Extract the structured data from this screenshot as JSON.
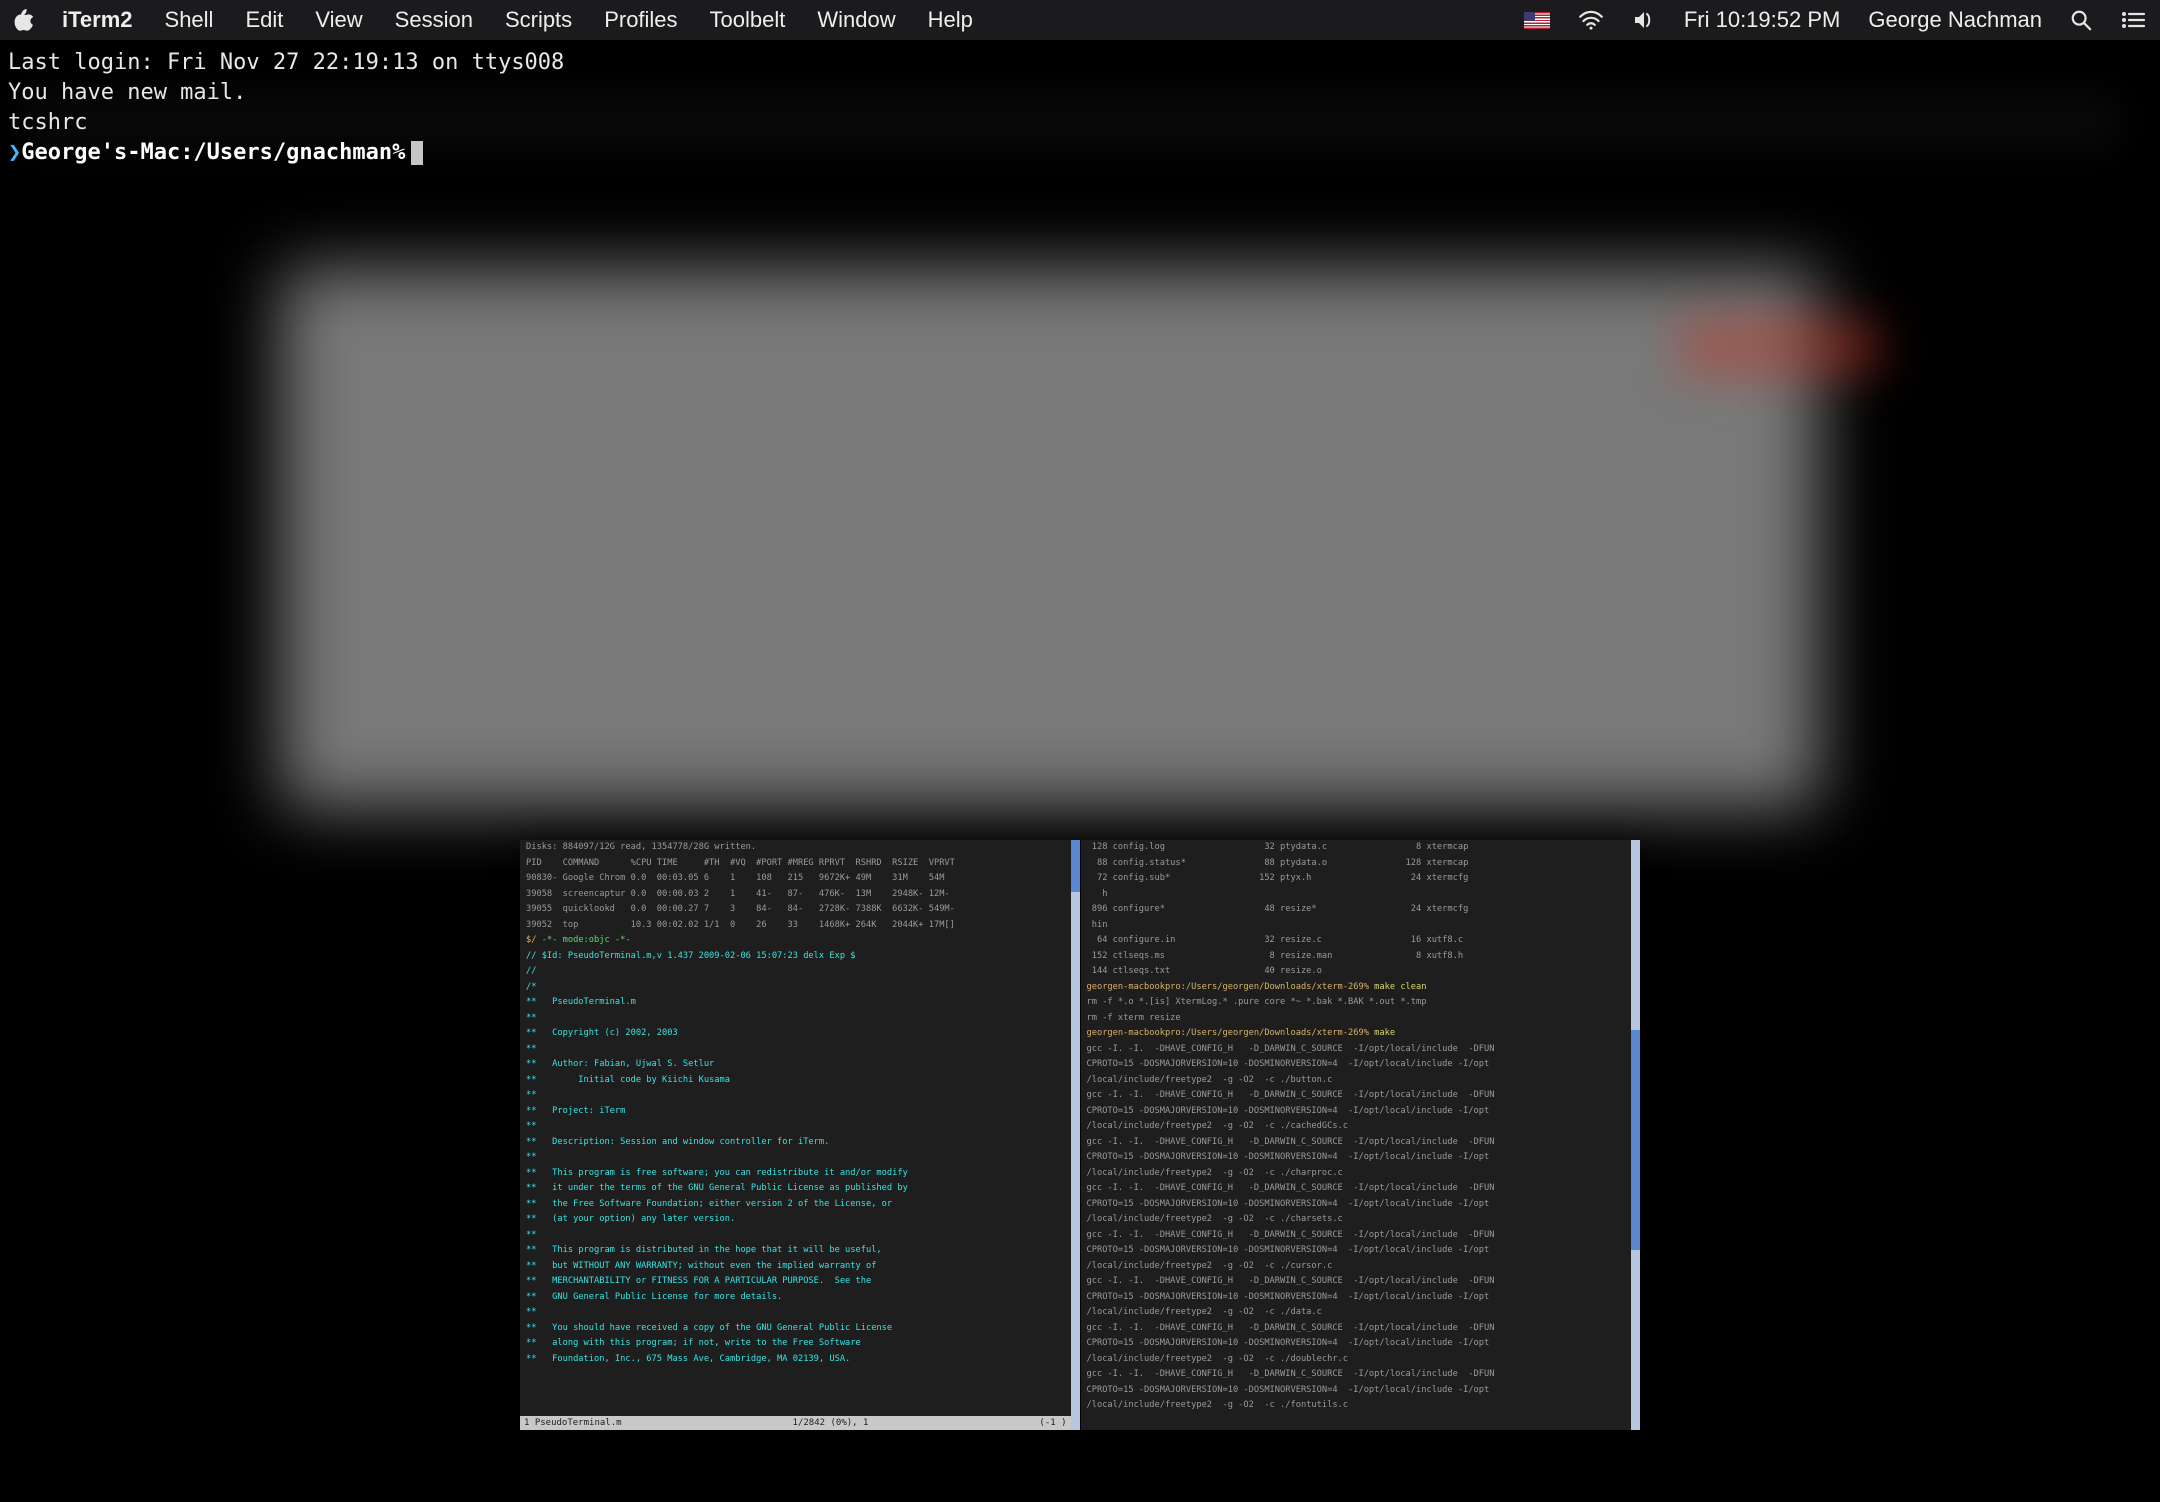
{
  "menu": {
    "app": "iTerm2",
    "items": [
      "Shell",
      "Edit",
      "View",
      "Session",
      "Scripts",
      "Profiles",
      "Toolbelt",
      "Window",
      "Help"
    ],
    "clock": "Fri 10:19:52 PM",
    "user": "George Nachman"
  },
  "terminal": {
    "login": "Last login: Fri Nov 27 22:19:13 on ttys008",
    "mail": "You have new mail.",
    "rc": "tcshrc",
    "prompt": "George's-Mac:/Users/gnachman%"
  },
  "inner_left": {
    "top_blur": "Disks: 884097/12G read, 1354778/28G written.",
    "headers": "PID    COMMAND      %CPU TIME     #TH  #VQ  #PORT #MREG RPRVT  RSHRD  RSIZE  VPRVT",
    "rows": [
      "90830- Google Chrom 0.0  00:03.05 6    1    108   215   9672K+ 49M    31M    54M",
      "39058  screencaptur 0.0  00:00.03 2    1    41-   87-   476K-  13M    2948K- 12M-",
      "39055  quicklookd   0.0  00:00.27 7    3    84-   84-   2728K- 7388K  6632K- 549M-",
      "39052  top          10.3 00:02.02 1/1  0    26    33    1468K+ 264K   2044K+ 17M[]"
    ],
    "objc_mode": "-*- mode:objc -*-",
    "sid": "// $Id: PseudoTerminal.m,v 1.437 2009-02-06 15:07:23 delx Exp $",
    "slashes": "//",
    "stars": "/*",
    "lines1": "**   PseudoTerminal.m",
    "lines2": "**   Copyright (c) 2002, 2003",
    "lines3": "**   Author: Fabian, Ujwal S. Setlur",
    "lines4": "**        Initial code by Kiichi Kusama",
    "lines5": "**   Project: iTerm",
    "lines6": "**   Description: Session and window controller for iTerm.",
    "gpl1": "**   This program is free software; you can redistribute it and/or modify",
    "gpl2": "**   it under the terms of the GNU General Public License as published by",
    "gpl3": "**   the Free Software Foundation; either version 2 of the License, or",
    "gpl4": "**   (at your option) any later version.",
    "gpl5": "**   This program is distributed in the hope that it will be useful,",
    "gpl6": "**   but WITHOUT ANY WARRANTY; without even the implied warranty of",
    "gpl7": "**   MERCHANTABILITY or FITNESS FOR A PARTICULAR PURPOSE.  See the",
    "gpl8": "**   GNU General Public License for more details.",
    "gpl9": "**   You should have received a copy of the GNU General Public License",
    "gpl10": "**   along with this program; if not, write to the Free Software",
    "gpl11": "**   Foundation, Inc., 675 Mass Ave, Cambridge, MA 02139, USA.",
    "status_left": "1  PseudoTerminal.m",
    "status_mid": "1/2842 (0%), 1",
    "status_right": "(-1 )"
  },
  "inner_right": {
    "ls": [
      " 128 config.log                   32 ptydata.c                 8 xtermcap",
      "  88 config.status*               88 ptydata.o               128 xtermcap",
      "  72 config.sub*                 152 ptyx.h                   24 xtermcfg",
      "   h",
      " 896 configure*                   48 resize*                  24 xtermcfg",
      " hin",
      "  64 configure.in                 32 resize.c                 16 xutf8.c",
      " 152 ctlseqs.ms                    8 resize.man                8 xutf8.h",
      " 144 ctlseqs.txt                  40 resize.o"
    ],
    "prompt1": "georgen-macbookpro:/Users/georgen/Downloads/xterm-269%",
    "cmd1": " make clean",
    "rm": "rm -f *.o *.[is] XtermLog.* .pure core *~ *.bak *.BAK *.out *.tmp",
    "rm2": "rm -f xterm resize",
    "prompt2": "georgen-macbookpro:/Users/georgen/Downloads/xterm-269%",
    "cmd2": " make",
    "gcc_lines": [
      "gcc -I. -I.  -DHAVE_CONFIG_H   -D_DARWIN_C_SOURCE  -I/opt/local/include  -DFUN",
      "CPROTO=15 -DOSMAJORVERSION=10 -DOSMINORVERSION=4  -I/opt/local/include -I/opt",
      "/local/include/freetype2  -g -O2  -c ./button.c",
      "gcc -I. -I.  -DHAVE_CONFIG_H   -D_DARWIN_C_SOURCE  -I/opt/local/include  -DFUN",
      "CPROTO=15 -DOSMAJORVERSION=10 -DOSMINORVERSION=4  -I/opt/local/include -I/opt",
      "/local/include/freetype2  -g -O2  -c ./cachedGCs.c",
      "gcc -I. -I.  -DHAVE_CONFIG_H   -D_DARWIN_C_SOURCE  -I/opt/local/include  -DFUN",
      "CPROTO=15 -DOSMAJORVERSION=10 -DOSMINORVERSION=4  -I/opt/local/include -I/opt",
      "/local/include/freetype2  -g -O2  -c ./charproc.c",
      "gcc -I. -I.  -DHAVE_CONFIG_H   -D_DARWIN_C_SOURCE  -I/opt/local/include  -DFUN",
      "CPROTO=15 -DOSMAJORVERSION=10 -DOSMINORVERSION=4  -I/opt/local/include -I/opt",
      "/local/include/freetype2  -g -O2  -c ./charsets.c",
      "gcc -I. -I.  -DHAVE_CONFIG_H   -D_DARWIN_C_SOURCE  -I/opt/local/include  -DFUN",
      "CPROTO=15 -DOSMAJORVERSION=10 -DOSMINORVERSION=4  -I/opt/local/include -I/opt",
      "/local/include/freetype2  -g -O2  -c ./cursor.c",
      "gcc -I. -I.  -DHAVE_CONFIG_H   -D_DARWIN_C_SOURCE  -I/opt/local/include  -DFUN",
      "CPROTO=15 -DOSMAJORVERSION=10 -DOSMINORVERSION=4  -I/opt/local/include -I/opt",
      "/local/include/freetype2  -g -O2  -c ./data.c",
      "gcc -I. -I.  -DHAVE_CONFIG_H   -D_DARWIN_C_SOURCE  -I/opt/local/include  -DFUN",
      "CPROTO=15 -DOSMAJORVERSION=10 -DOSMINORVERSION=4  -I/opt/local/include -I/opt",
      "/local/include/freetype2  -g -O2  -c ./doublechr.c",
      "gcc -I. -I.  -DHAVE_CONFIG_H   -D_DARWIN_C_SOURCE  -I/opt/local/include  -DFUN",
      "CPROTO=15 -DOSMAJORVERSION=10 -DOSMINORVERSION=4  -I/opt/local/include -I/opt",
      "/local/include/freetype2  -g -O2  -c ./fontutils.c"
    ]
  }
}
